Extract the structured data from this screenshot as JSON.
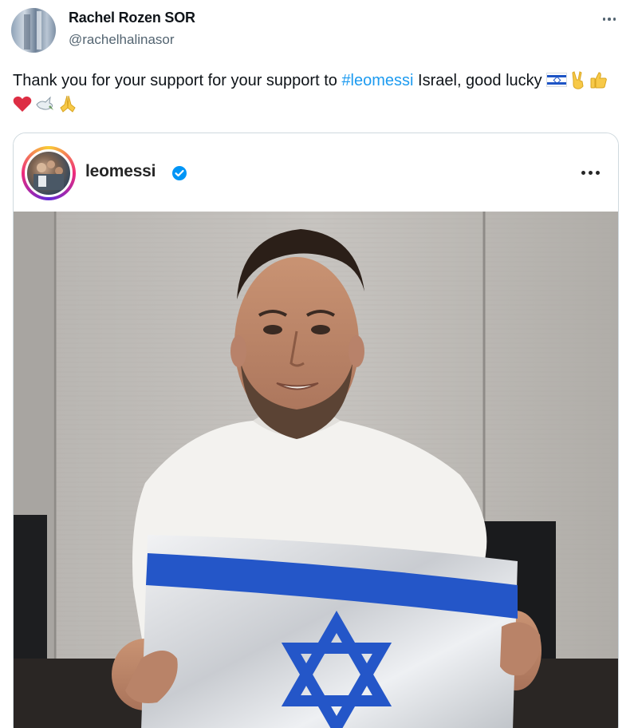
{
  "tweet": {
    "author": {
      "display_name": "Rachel Rozen SOR",
      "handle": "@rachelhalinasor"
    },
    "text": {
      "part1": "Thank you for your support for your support to ",
      "hashtag": "#leomessi",
      "part2": " Israel, good lucky "
    },
    "emojis": [
      "israel-flag",
      "victory-hand",
      "thumbs-up",
      "red-heart",
      "dove",
      "folded-hands"
    ]
  },
  "embed": {
    "username": "leomessi",
    "verified": true
  },
  "colors": {
    "text": "#0f1419",
    "secondary": "#536471",
    "link": "#1d9bf0",
    "border": "#cfd9de",
    "flag_blue": "#1d54c5",
    "verified": "#0095f6"
  }
}
